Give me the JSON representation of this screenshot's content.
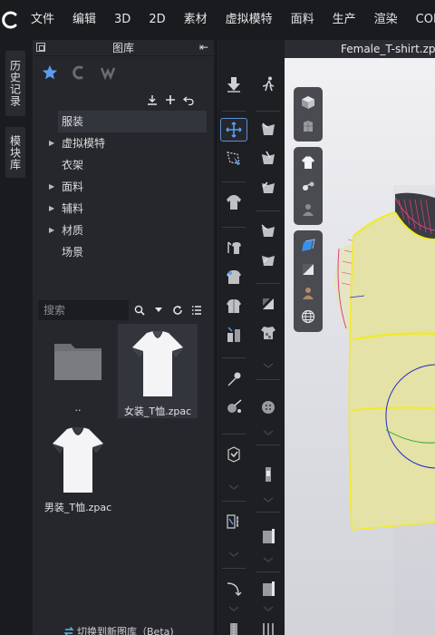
{
  "menubar": {
    "items": [
      "文件",
      "编辑",
      "3D",
      "2D",
      "素材",
      "虚拟模特",
      "面料",
      "生产",
      "渲染",
      "CON"
    ]
  },
  "vtabs": [
    "历史记录",
    "模块库"
  ],
  "library": {
    "title": "图库",
    "tree": [
      {
        "label": "服装",
        "expandable": false,
        "selected": true
      },
      {
        "label": "虚拟模特",
        "expandable": true
      },
      {
        "label": "衣架",
        "expandable": false
      },
      {
        "label": "面料",
        "expandable": true
      },
      {
        "label": "辅料",
        "expandable": true
      },
      {
        "label": "材质",
        "expandable": true
      },
      {
        "label": "场景",
        "expandable": false
      }
    ],
    "search_placeholder": "搜索",
    "files": [
      {
        "label": "..",
        "icon": "folder-icon"
      },
      {
        "label": "女装_T恤.zpac",
        "icon": "tshirt-white-icon",
        "selected": true
      },
      {
        "label": "男装_T恤.zpac",
        "icon": "tshirt-white-icon"
      }
    ],
    "switch_link": "切换到新图库（Beta)"
  },
  "viewport": {
    "tab_title": "Female_T-shirt.zpac"
  },
  "colors": {
    "accent": "#5a8fd6",
    "garment": "#e4e2a6",
    "seam_yellow": "#f2ea2a",
    "seam_pink": "#e0408a"
  }
}
